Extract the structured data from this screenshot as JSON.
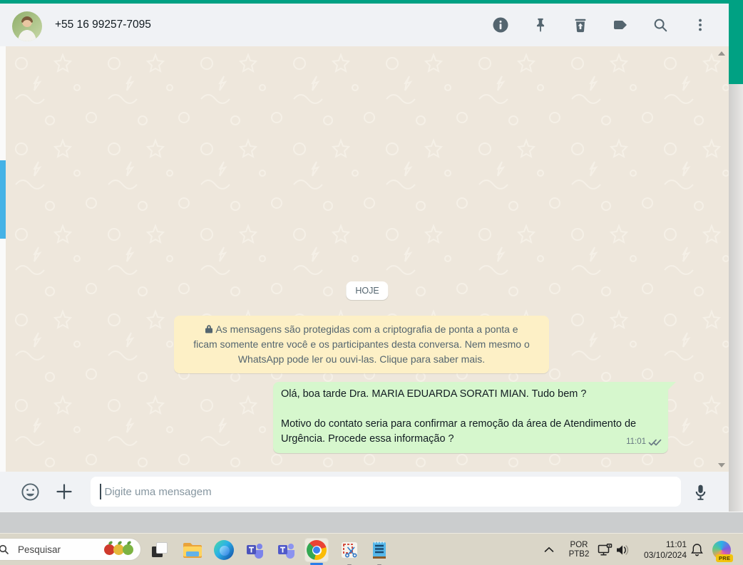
{
  "app": {
    "header": {
      "title": "+55 16 99257-7095"
    },
    "chat": {
      "date_badge": "HOJE",
      "encryption_notice": "As mensagens são protegidas com a criptografia de ponta a ponta e ficam somente entre você e os participantes desta conversa. Nem mesmo o WhatsApp pode ler ou ouvi-las. Clique para saber mais.",
      "message": {
        "text1": "Olá, boa tarde Dra. MARIA EDUARDA SORATI MIAN. Tudo bem ?",
        "text2": "Motivo do contato seria para confirmar a remoção da área de Atendimento de Urgência. Procede essa informação ?",
        "time": "11:01",
        "status": "delivered-double-check"
      }
    },
    "composer": {
      "placeholder": "Digite uma mensagem"
    }
  },
  "taskbar": {
    "search_placeholder": "Pesquisar",
    "tray": {
      "lang_top": "POR",
      "lang_bottom": "PTB2",
      "time": "11:01",
      "date": "03/10/2024",
      "copilot_badge": "PRE"
    }
  },
  "colors": {
    "accent_teal": "#00a183",
    "header_bg": "#f0f2f5",
    "chat_bg": "#eee7dc",
    "outgoing_bubble": "#d6f7cd",
    "notice_bg": "#fdf0c6",
    "icon_slate": "#54656f",
    "chrome_blue": "#2b7de9",
    "left_thumb_blue": "#45b2e6"
  }
}
